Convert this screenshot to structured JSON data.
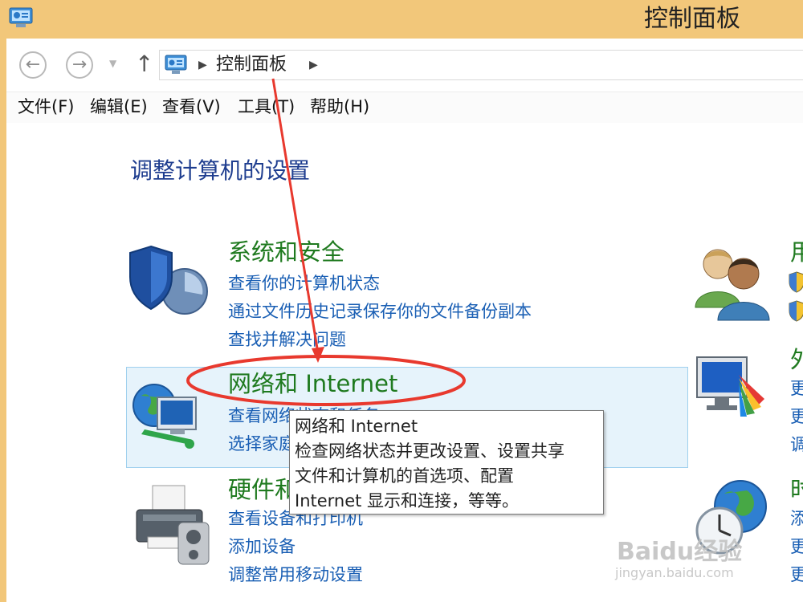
{
  "window": {
    "title": "控制面板"
  },
  "address": {
    "current": "控制面板"
  },
  "menu": [
    {
      "label": "文件(F)"
    },
    {
      "label": "编辑(E)"
    },
    {
      "label": "查看(V)"
    },
    {
      "label": "工具(T)"
    },
    {
      "label": "帮助(H)"
    }
  ],
  "page": {
    "heading": "调整计算机的设置"
  },
  "categories": [
    {
      "title": "系统和安全",
      "links": [
        "查看你的计算机状态",
        "通过文件历史记录保存你的文件备份副本",
        "查找并解决问题"
      ],
      "icon": "shield-icon"
    },
    {
      "title": "网络和 Internet",
      "links": [
        "查看网络状态和任务",
        "选择家庭组和共享选项"
      ],
      "icon": "network-globe-icon"
    },
    {
      "title": "硬件和声音",
      "links": [
        "查看设备和打印机",
        "添加设备",
        "调整常用移动设置"
      ],
      "icon": "printer-icon"
    }
  ],
  "right_categories": [
    {
      "title": "用",
      "links": [
        "",
        ""
      ],
      "icon": "users-icon"
    },
    {
      "title": "外",
      "links": [
        "更",
        "更",
        "调"
      ],
      "icon": "display-palette-icon"
    },
    {
      "title": "时",
      "links": [
        "添",
        "更",
        "更"
      ],
      "icon": "clock-globe-icon"
    }
  ],
  "tooltip": {
    "lines": [
      "网络和 Internet",
      "检查网络状态并更改设置、设置共享",
      "文件和计算机的首选项、配置",
      "Internet 显示和连接，等等。"
    ]
  },
  "watermark": {
    "brand": "Baidu经验",
    "url": "jingyan.baidu.com"
  },
  "colors": {
    "accent": "#1a5fb4",
    "category_green": "#1f7a1f",
    "annotation_red": "#e8392e",
    "window_frame": "#f2c77a"
  }
}
